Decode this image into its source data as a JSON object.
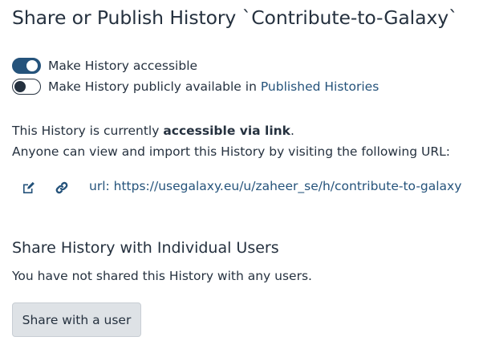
{
  "page": {
    "title": "Share or Publish History `Contribute-to-Galaxy`"
  },
  "toggles": [
    {
      "label": "Make History accessible",
      "checked": true
    },
    {
      "label_prefix": "Make History publicly available in ",
      "link_text": "Published Histories",
      "checked": false
    }
  ],
  "status": {
    "prefix": "This History is currently ",
    "emphasis": "accessible via link",
    "suffix": ".",
    "line2": "Anyone can view and import this History by visiting the following URL:"
  },
  "url_row": {
    "edit_icon": "edit-icon",
    "link_icon": "link-icon",
    "url_text": "url: https://usegalaxy.eu/u/zaheer_se/h/contribute-to-galaxy"
  },
  "share_users": {
    "heading": "Share History with Individual Users",
    "empty_text": "You have not shared this History with any users.",
    "button_label": "Share with a user"
  },
  "colors": {
    "text": "#25313f",
    "accent": "#25537b",
    "button_bg": "#dee2e6"
  }
}
